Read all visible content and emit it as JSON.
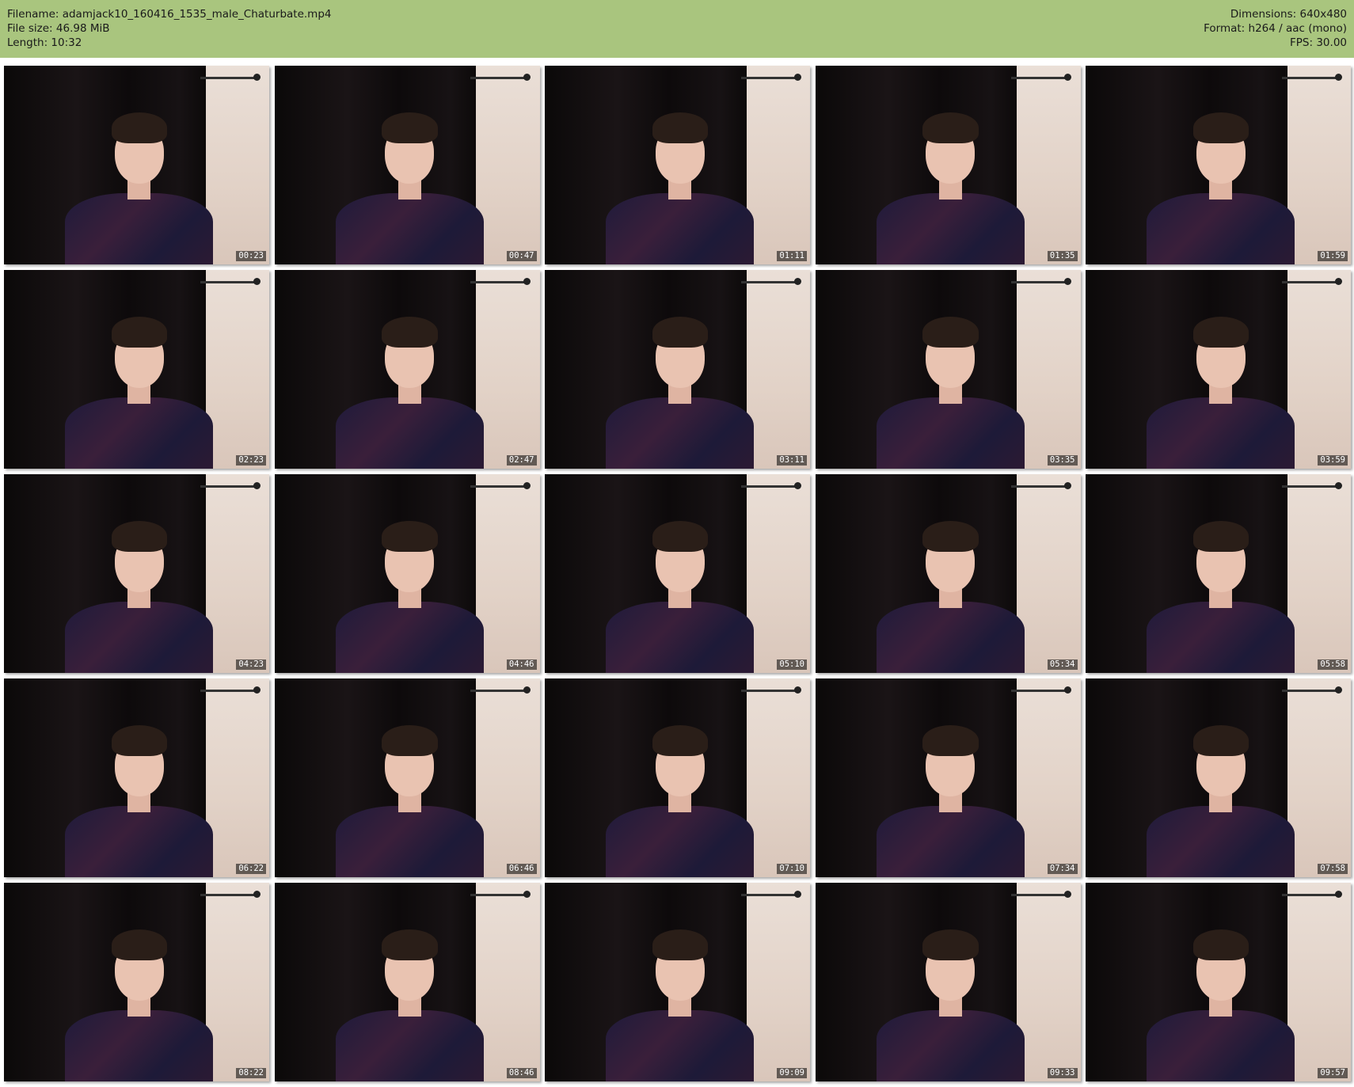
{
  "header": {
    "left": [
      "Filename: adamjack10_160416_1535_male_Chaturbate.mp4",
      "File size: 46.98 MiB",
      "Length: 10:32"
    ],
    "right": [
      "Dimensions: 640x480",
      "Format: h264 / aac (mono)",
      "FPS: 30.00"
    ],
    "background_color": "#a9c57e"
  },
  "thumbnails": [
    {
      "time": "00:23"
    },
    {
      "time": "00:47"
    },
    {
      "time": "01:11"
    },
    {
      "time": "01:35"
    },
    {
      "time": "01:59"
    },
    {
      "time": "02:23"
    },
    {
      "time": "02:47"
    },
    {
      "time": "03:11"
    },
    {
      "time": "03:35"
    },
    {
      "time": "03:59"
    },
    {
      "time": "04:23"
    },
    {
      "time": "04:46"
    },
    {
      "time": "05:10"
    },
    {
      "time": "05:34"
    },
    {
      "time": "05:58"
    },
    {
      "time": "06:22"
    },
    {
      "time": "06:46"
    },
    {
      "time": "07:10"
    },
    {
      "time": "07:34"
    },
    {
      "time": "07:58"
    },
    {
      "time": "08:22"
    },
    {
      "time": "08:46"
    },
    {
      "time": "09:09"
    },
    {
      "time": "09:33"
    },
    {
      "time": "09:57"
    }
  ]
}
